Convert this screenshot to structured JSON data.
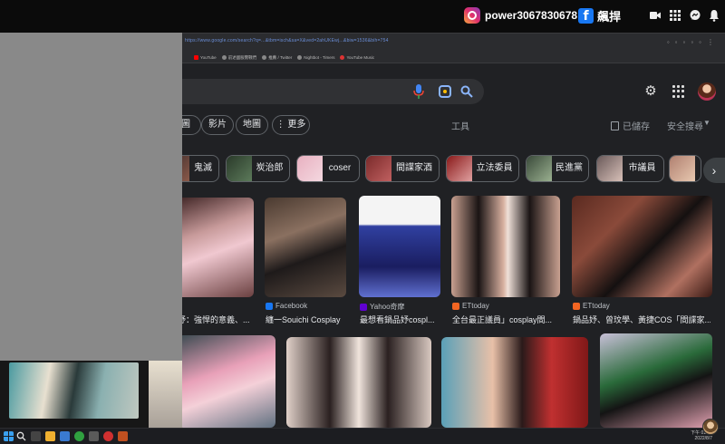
{
  "stream_overlay": {
    "instagram_handle": "power3067830678",
    "facebook_name": "飆捍",
    "icons": [
      "camera-icon",
      "grid-icon",
      "chat-icon",
      "bell-icon"
    ]
  },
  "browser": {
    "url_text": "https://www.google.com/search?q=...&tbm=isch&sa=X&ved=2ahUKEwj...&biw=1536&bih=754",
    "bookmarks": [
      "YouTube",
      "前述國服實戰們",
      "推薦 / Twitter",
      "Nightbot - Timers",
      "YouTube Music"
    ]
  },
  "google": {
    "tabs": [
      {
        "label": "圖"
      },
      {
        "label": "影片"
      },
      {
        "label": "地圖"
      },
      {
        "label": "⋮ 更多"
      }
    ],
    "tools_label": "工具",
    "saved_label": "已儲存",
    "safe_search_label": "安全搜尋",
    "chips": [
      "鬼滅",
      "炭治郎",
      "coser",
      "間諜家酒",
      "立法委員",
      "民進黨",
      "市議員"
    ],
    "results": [
      {
        "source": "",
        "title": "妤：強悍的意義、..."
      },
      {
        "source": "Facebook",
        "title": "纏一Souichi Cosplay"
      },
      {
        "source": "Yahoo奇摩",
        "title": "最想看鍋品妤cospl..."
      },
      {
        "source": "ETtoday",
        "title": "全台最正議員」cosplay間..."
      },
      {
        "source": "ETtoday",
        "title": "鍋品妤、曾玟學、黃捷COS「間諜家..."
      }
    ]
  },
  "taskbar": {
    "time": "下午 01:05",
    "date": "2022/8/7"
  },
  "colors": {
    "page_bg": "#202124",
    "overlay_gray": "#898989",
    "accent_blue": "#8ab4f8"
  }
}
